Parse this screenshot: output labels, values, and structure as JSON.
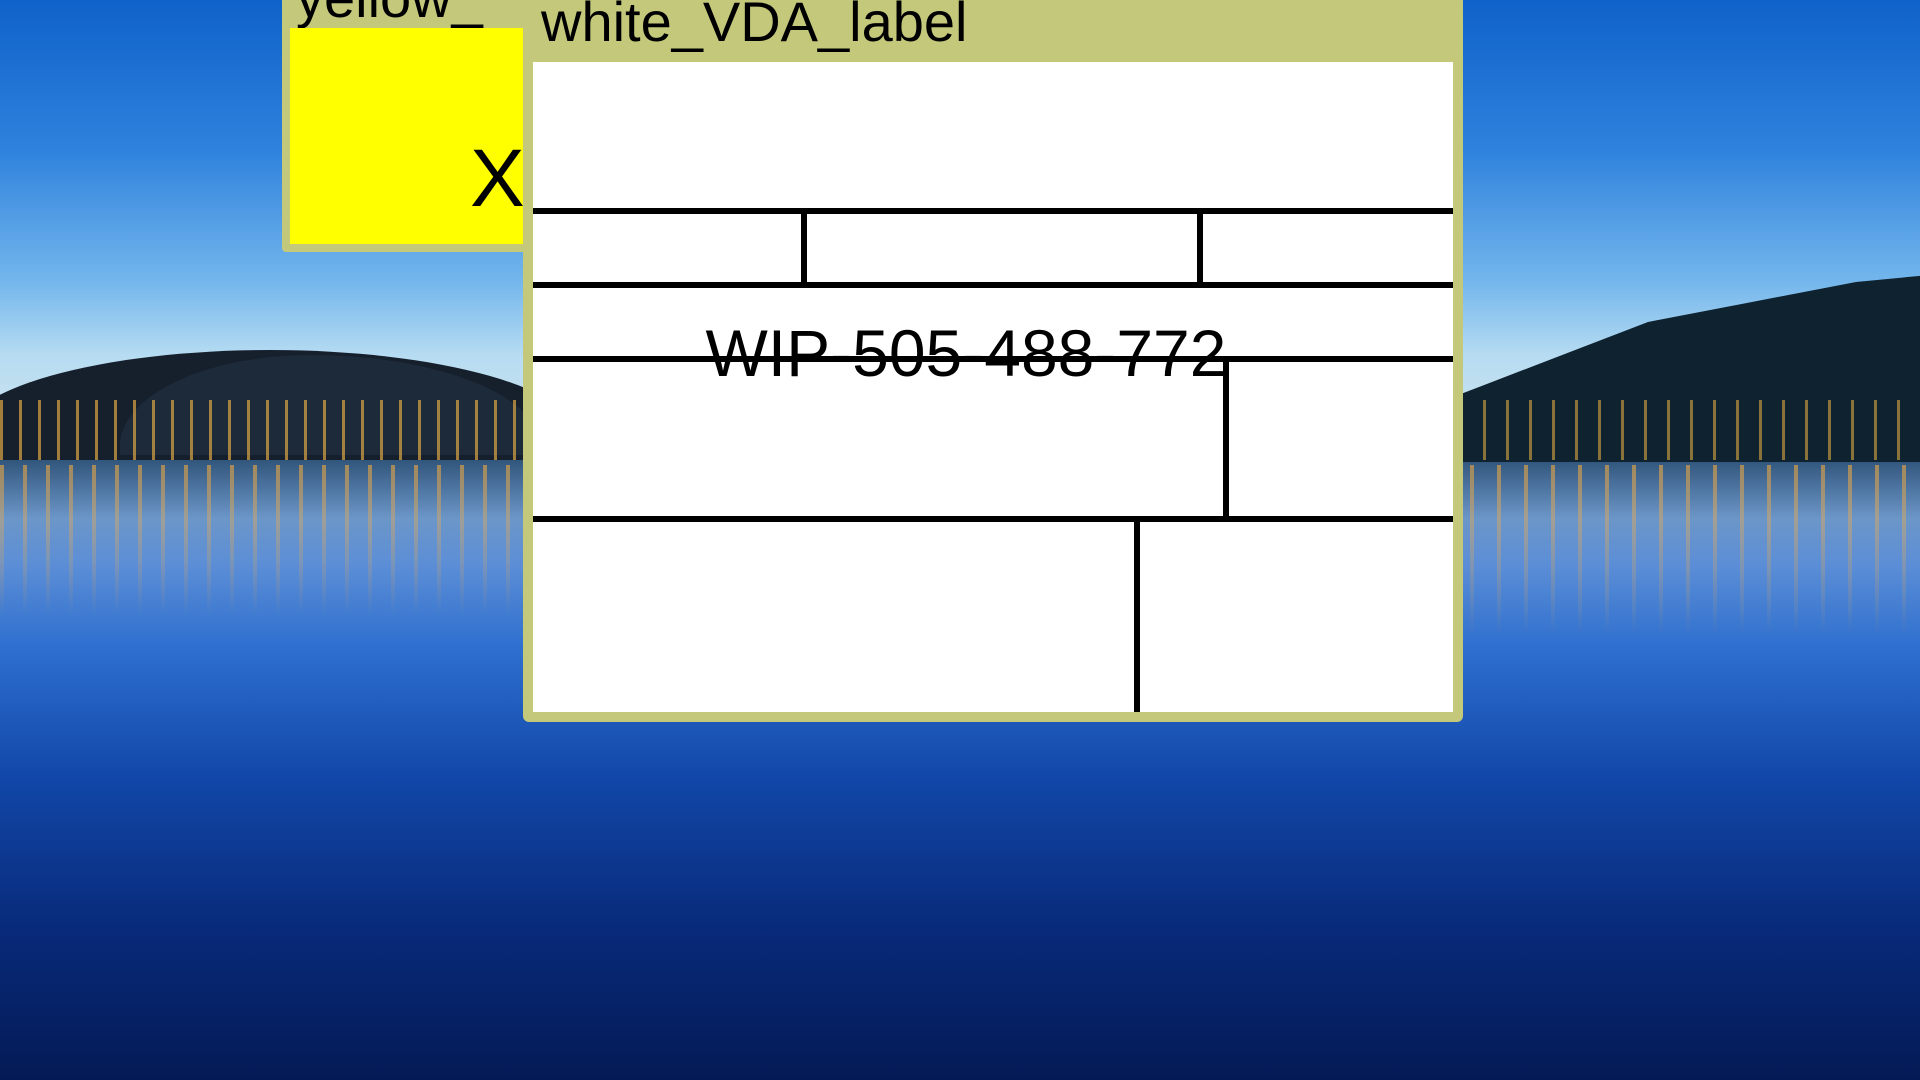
{
  "desktop": {
    "wallpaper": "night-lake-city-lights"
  },
  "windows": {
    "yellow": {
      "title": "yellow_",
      "body_text": "XY",
      "body_color": "#ffff00",
      "frame_color": "#c3c87a"
    },
    "white": {
      "title": "white_VDA_label",
      "body_color": "#ffffff",
      "frame_color": "#c3c87a",
      "label": {
        "id_text": "WIP-505-488-772"
      }
    }
  }
}
